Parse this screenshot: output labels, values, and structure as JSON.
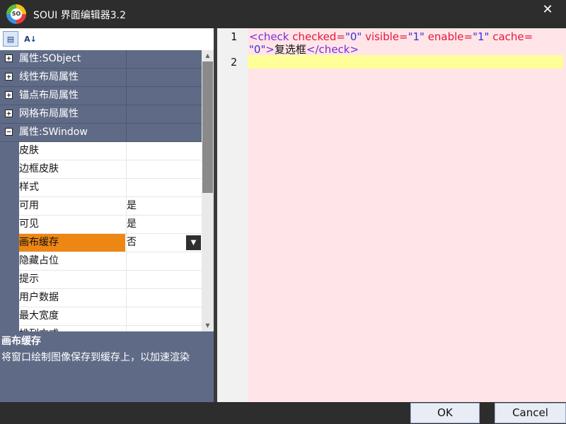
{
  "window": {
    "title": "SOUI 界面编辑器3.2",
    "logo_text": "SO",
    "close_glyph": "✕"
  },
  "toolbar": {
    "categorized_icon": "categorized-view-icon",
    "sort_icon": "sort-az-icon",
    "categorized_glyph": "▤",
    "sort_glyph": "A↓"
  },
  "properties": {
    "groups": [
      {
        "label": "属性:SObject",
        "expanded": false,
        "expander": "+"
      },
      {
        "label": "线性布局属性",
        "expanded": false,
        "expander": "+"
      },
      {
        "label": "锚点布局属性",
        "expanded": false,
        "expander": "+"
      },
      {
        "label": "网格布局属性",
        "expanded": false,
        "expander": "+"
      },
      {
        "label": "属性:SWindow",
        "expanded": true,
        "expander": "−"
      }
    ],
    "items": [
      {
        "name": "皮肤",
        "value": ""
      },
      {
        "name": "边框皮肤",
        "value": ""
      },
      {
        "name": "样式",
        "value": ""
      },
      {
        "name": "可用",
        "value": "是"
      },
      {
        "name": "可见",
        "value": "是"
      },
      {
        "name": "画布缓存",
        "value": "否",
        "selected": true
      },
      {
        "name": "隐藏占位",
        "value": ""
      },
      {
        "name": "提示",
        "value": ""
      },
      {
        "name": "用户数据",
        "value": ""
      },
      {
        "name": "最大宽度",
        "value": ""
      },
      {
        "name": "排列方式",
        "value": ""
      }
    ],
    "dropdown_glyph": "▼",
    "scroll_up": "▲",
    "scroll_down": "▼"
  },
  "description": {
    "title": "画布缓存",
    "text": "将窗口绘制图像保存到缓存上，以加速渲染"
  },
  "editor": {
    "line_numbers": [
      "1",
      "2"
    ],
    "line1": {
      "open_tag": "<check",
      "attr1": " checked=",
      "val1": "\"0\"",
      "attr2": " visible=",
      "val2": "\"1\"",
      "attr3": " enable=",
      "val3": "\"1\"",
      "attr4": " cache=",
      "val4": "\"0\"",
      "gt": ">",
      "text": "复选框",
      "close_tag": "</check>"
    },
    "colors": {
      "tag": "#7b2dd6",
      "attr": "#e3163a",
      "value": "#3b2fd6",
      "background": "#ffe5e8",
      "current_line": "#ffff99"
    }
  },
  "buttons": {
    "ok": "OK",
    "cancel": "Cancel"
  },
  "colors": {
    "chrome": "#2d2d2d",
    "panel": "#5f6b86",
    "selection": "#ee8613"
  }
}
